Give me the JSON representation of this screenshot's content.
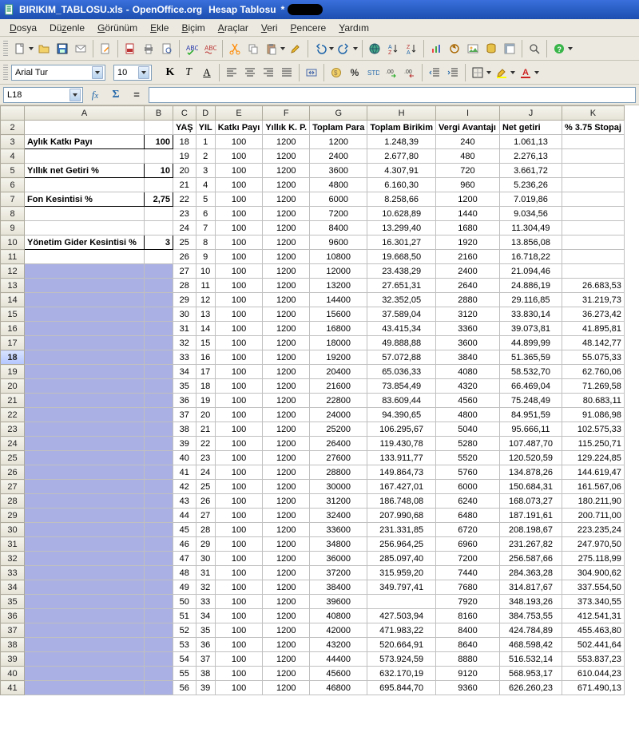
{
  "title": {
    "filename": "BIRIKIM_TABLOSU.xls",
    "app": "OpenOffice.org",
    "module": "Hesap Tablosu",
    "dirty": "*"
  },
  "menu": [
    "Dosya",
    "Düzenle",
    "Görünüm",
    "Ekle",
    "Biçim",
    "Araçlar",
    "Veri",
    "Pencere",
    "Yardım"
  ],
  "format": {
    "font": "Arial Tur",
    "size": "10"
  },
  "ref": {
    "cell": "L18",
    "formula": ""
  },
  "cols": [
    "A",
    "B",
    "C",
    "D",
    "E",
    "F",
    "G",
    "H",
    "I",
    "J",
    "K"
  ],
  "headers": {
    "c": "YAŞ",
    "d": "YIL",
    "e": "Katkı Payı",
    "f": "Yıllık K. P.",
    "g": "Toplam Para",
    "h": "Toplam Birikim",
    "i": "Vergi Avantajı",
    "j": "Net getiri",
    "k": "% 3.75 Stopaj"
  },
  "labels": {
    "r3a": "Aylık Katkı Payı",
    "r3b": "100",
    "r5a": "Yıllık net Getiri %",
    "r5b": "10",
    "r7a": "Fon Kesintisi %",
    "r7b": "2,75",
    "r10a": "Yönetim Gider Kesintisi %",
    "r10b": "3"
  },
  "rows": [
    {
      "n": 3,
      "c": "18",
      "d": "1",
      "e": "100",
      "f": "1200",
      "g": "1200",
      "h": "1.248,39",
      "i": "240",
      "j": "1.061,13",
      "k": ""
    },
    {
      "n": 4,
      "c": "19",
      "d": "2",
      "e": "100",
      "f": "1200",
      "g": "2400",
      "h": "2.677,80",
      "i": "480",
      "j": "2.276,13",
      "k": ""
    },
    {
      "n": 5,
      "c": "20",
      "d": "3",
      "e": "100",
      "f": "1200",
      "g": "3600",
      "h": "4.307,91",
      "i": "720",
      "j": "3.661,72",
      "k": ""
    },
    {
      "n": 6,
      "c": "21",
      "d": "4",
      "e": "100",
      "f": "1200",
      "g": "4800",
      "h": "6.160,30",
      "i": "960",
      "j": "5.236,26",
      "k": ""
    },
    {
      "n": 7,
      "c": "22",
      "d": "5",
      "e": "100",
      "f": "1200",
      "g": "6000",
      "h": "8.258,66",
      "i": "1200",
      "j": "7.019,86",
      "k": ""
    },
    {
      "n": 8,
      "c": "23",
      "d": "6",
      "e": "100",
      "f": "1200",
      "g": "7200",
      "h": "10.628,89",
      "i": "1440",
      "j": "9.034,56",
      "k": ""
    },
    {
      "n": 9,
      "c": "24",
      "d": "7",
      "e": "100",
      "f": "1200",
      "g": "8400",
      "h": "13.299,40",
      "i": "1680",
      "j": "11.304,49",
      "k": ""
    },
    {
      "n": 10,
      "c": "25",
      "d": "8",
      "e": "100",
      "f": "1200",
      "g": "9600",
      "h": "16.301,27",
      "i": "1920",
      "j": "13.856,08",
      "k": ""
    },
    {
      "n": 11,
      "c": "26",
      "d": "9",
      "e": "100",
      "f": "1200",
      "g": "10800",
      "h": "19.668,50",
      "i": "2160",
      "j": "16.718,22",
      "k": ""
    },
    {
      "n": 12,
      "c": "27",
      "d": "10",
      "e": "100",
      "f": "1200",
      "g": "12000",
      "h": "23.438,29",
      "i": "2400",
      "j": "21.094,46",
      "k": ""
    },
    {
      "n": 13,
      "c": "28",
      "d": "11",
      "e": "100",
      "f": "1200",
      "g": "13200",
      "h": "27.651,31",
      "i": "2640",
      "j": "24.886,19",
      "k": "26.683,53"
    },
    {
      "n": 14,
      "c": "29",
      "d": "12",
      "e": "100",
      "f": "1200",
      "g": "14400",
      "h": "32.352,05",
      "i": "2880",
      "j": "29.116,85",
      "k": "31.219,73"
    },
    {
      "n": 15,
      "c": "30",
      "d": "13",
      "e": "100",
      "f": "1200",
      "g": "15600",
      "h": "37.589,04",
      "i": "3120",
      "j": "33.830,14",
      "k": "36.273,42"
    },
    {
      "n": 16,
      "c": "31",
      "d": "14",
      "e": "100",
      "f": "1200",
      "g": "16800",
      "h": "43.415,34",
      "i": "3360",
      "j": "39.073,81",
      "k": "41.895,81"
    },
    {
      "n": 17,
      "c": "32",
      "d": "15",
      "e": "100",
      "f": "1200",
      "g": "18000",
      "h": "49.888,88",
      "i": "3600",
      "j": "44.899,99",
      "k": "48.142,77"
    },
    {
      "n": 18,
      "c": "33",
      "d": "16",
      "e": "100",
      "f": "1200",
      "g": "19200",
      "h": "57.072,88",
      "i": "3840",
      "j": "51.365,59",
      "k": "55.075,33"
    },
    {
      "n": 19,
      "c": "34",
      "d": "17",
      "e": "100",
      "f": "1200",
      "g": "20400",
      "h": "65.036,33",
      "i": "4080",
      "j": "58.532,70",
      "k": "62.760,06"
    },
    {
      "n": 20,
      "c": "35",
      "d": "18",
      "e": "100",
      "f": "1200",
      "g": "21600",
      "h": "73.854,49",
      "i": "4320",
      "j": "66.469,04",
      "k": "71.269,58"
    },
    {
      "n": 21,
      "c": "36",
      "d": "19",
      "e": "100",
      "f": "1200",
      "g": "22800",
      "h": "83.609,44",
      "i": "4560",
      "j": "75.248,49",
      "k": "80.683,11"
    },
    {
      "n": 22,
      "c": "37",
      "d": "20",
      "e": "100",
      "f": "1200",
      "g": "24000",
      "h": "94.390,65",
      "i": "4800",
      "j": "84.951,59",
      "k": "91.086,98"
    },
    {
      "n": 23,
      "c": "38",
      "d": "21",
      "e": "100",
      "f": "1200",
      "g": "25200",
      "h": "106.295,67",
      "i": "5040",
      "j": "95.666,11",
      "k": "102.575,33"
    },
    {
      "n": 24,
      "c": "39",
      "d": "22",
      "e": "100",
      "f": "1200",
      "g": "26400",
      "h": "119.430,78",
      "i": "5280",
      "j": "107.487,70",
      "k": "115.250,71"
    },
    {
      "n": 25,
      "c": "40",
      "d": "23",
      "e": "100",
      "f": "1200",
      "g": "27600",
      "h": "133.911,77",
      "i": "5520",
      "j": "120.520,59",
      "k": "129.224,85"
    },
    {
      "n": 26,
      "c": "41",
      "d": "24",
      "e": "100",
      "f": "1200",
      "g": "28800",
      "h": "149.864,73",
      "i": "5760",
      "j": "134.878,26",
      "k": "144.619,47"
    },
    {
      "n": 27,
      "c": "42",
      "d": "25",
      "e": "100",
      "f": "1200",
      "g": "30000",
      "h": "167.427,01",
      "i": "6000",
      "j": "150.684,31",
      "k": "161.567,06"
    },
    {
      "n": 28,
      "c": "43",
      "d": "26",
      "e": "100",
      "f": "1200",
      "g": "31200",
      "h": "186.748,08",
      "i": "6240",
      "j": "168.073,27",
      "k": "180.211,90"
    },
    {
      "n": 29,
      "c": "44",
      "d": "27",
      "e": "100",
      "f": "1200",
      "g": "32400",
      "h": "207.990,68",
      "i": "6480",
      "j": "187.191,61",
      "k": "200.711,00"
    },
    {
      "n": 30,
      "c": "45",
      "d": "28",
      "e": "100",
      "f": "1200",
      "g": "33600",
      "h": "231.331,85",
      "i": "6720",
      "j": "208.198,67",
      "k": "223.235,24"
    },
    {
      "n": 31,
      "c": "46",
      "d": "29",
      "e": "100",
      "f": "1200",
      "g": "34800",
      "h": "256.964,25",
      "i": "6960",
      "j": "231.267,82",
      "k": "247.970,50"
    },
    {
      "n": 32,
      "c": "47",
      "d": "30",
      "e": "100",
      "f": "1200",
      "g": "36000",
      "h": "285.097,40",
      "i": "7200",
      "j": "256.587,66",
      "k": "275.118,99"
    },
    {
      "n": 33,
      "c": "48",
      "d": "31",
      "e": "100",
      "f": "1200",
      "g": "37200",
      "h": "315.959,20",
      "i": "7440",
      "j": "284.363,28",
      "k": "304.900,62"
    },
    {
      "n": 34,
      "c": "49",
      "d": "32",
      "e": "100",
      "f": "1200",
      "g": "38400",
      "h": "349.797,41",
      "i": "7680",
      "j": "314.817,67",
      "k": "337.554,50"
    },
    {
      "n": 35,
      "c": "50",
      "d": "33",
      "e": "100",
      "f": "1200",
      "g": "39600",
      "h": "",
      "i": "7920",
      "j": "348.193,26",
      "k": "373.340,55"
    },
    {
      "n": 36,
      "c": "51",
      "d": "34",
      "e": "100",
      "f": "1200",
      "g": "40800",
      "h": "427.503,94",
      "i": "8160",
      "j": "384.753,55",
      "k": "412.541,31"
    },
    {
      "n": 37,
      "c": "52",
      "d": "35",
      "e": "100",
      "f": "1200",
      "g": "42000",
      "h": "471.983,22",
      "i": "8400",
      "j": "424.784,89",
      "k": "455.463,80"
    },
    {
      "n": 38,
      "c": "53",
      "d": "36",
      "e": "100",
      "f": "1200",
      "g": "43200",
      "h": "520.664,91",
      "i": "8640",
      "j": "468.598,42",
      "k": "502.441,64"
    },
    {
      "n": 39,
      "c": "54",
      "d": "37",
      "e": "100",
      "f": "1200",
      "g": "44400",
      "h": "573.924,59",
      "i": "8880",
      "j": "516.532,14",
      "k": "553.837,23"
    },
    {
      "n": 40,
      "c": "55",
      "d": "38",
      "e": "100",
      "f": "1200",
      "g": "45600",
      "h": "632.170,19",
      "i": "9120",
      "j": "568.953,17",
      "k": "610.044,23"
    },
    {
      "n": 41,
      "c": "56",
      "d": "39",
      "e": "100",
      "f": "1200",
      "g": "46800",
      "h": "695.844,70",
      "i": "9360",
      "j": "626.260,23",
      "k": "671.490,13"
    }
  ]
}
